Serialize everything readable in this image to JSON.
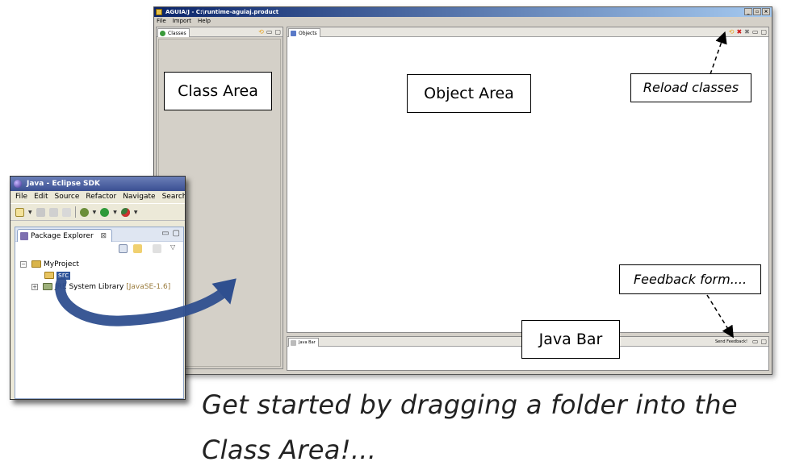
{
  "main_window": {
    "title": "AGUIA/J - C:\\runtime-aguiaj.product",
    "menu": [
      "File",
      "Import",
      "Help"
    ],
    "classes_tab": "Classes",
    "objects_tab": "Objects",
    "java_bar_tab": "Java Bar",
    "send_feedback": "Send Feedback!"
  },
  "eclipse_window": {
    "title": "Java - Eclipse SDK",
    "menu": [
      "File",
      "Edit",
      "Source",
      "Refactor",
      "Navigate",
      "Search"
    ],
    "package_explorer_tab": "Package Explorer",
    "tree": {
      "project": "MyProject",
      "src": "src",
      "jre_prefix": "JRE System Library",
      "jre_version": "[JavaSE-1.6]"
    }
  },
  "annotations": {
    "class_area": "Class Area",
    "object_area": "Object Area",
    "java_bar": "Java Bar",
    "reload_classes": "Reload classes",
    "feedback_form": "Feedback form...."
  },
  "caption": "Get started by dragging a folder into the Class Area!...",
  "colors": {
    "title_bar": "#0a246a",
    "eclipse_title": "#3a4f92",
    "selection": "#31569b",
    "drag_arrow": "#2f4f8f",
    "reload_icon": "#e8a21c",
    "delete_icon": "#d01818"
  },
  "icons": [
    "app-icon",
    "classes-tab-icon",
    "objects-tab-icon",
    "reload-icon",
    "delete-icon",
    "remove-all-icon",
    "minimize-icon",
    "maximize-icon",
    "package-explorer-icon",
    "folder-icon",
    "library-icon"
  ]
}
